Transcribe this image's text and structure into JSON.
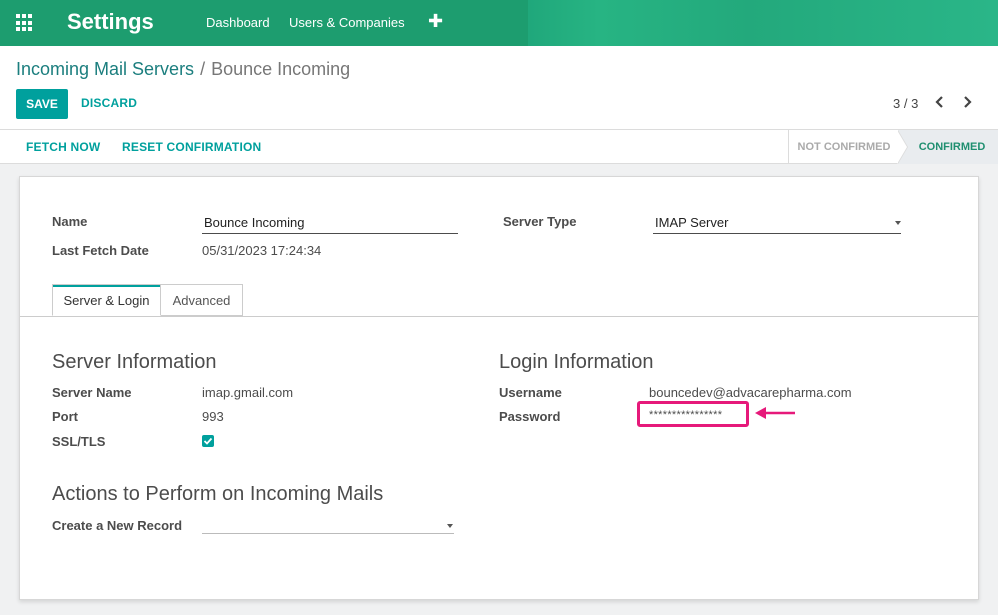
{
  "navbar": {
    "apps_icon": "apps-grid-icon",
    "brand": "Settings",
    "items": [
      "Dashboard",
      "Users & Companies"
    ],
    "plus": "✚",
    "color": "#1fa67a"
  },
  "breadcrumb": {
    "parent": "Incoming Mail Servers",
    "separator": "/",
    "current": "Bounce Incoming"
  },
  "actions": {
    "save": "SAVE",
    "discard": "DISCARD",
    "accent": "#00a09d"
  },
  "pager": {
    "value": "3 / 3",
    "prev_icon": "chevron-left-icon",
    "next_icon": "chevron-right-icon"
  },
  "statusbar": {
    "fetch_now": "FETCH NOW",
    "reset_confirmation": "RESET CONFIRMATION",
    "stages": [
      "NOT CONFIRMED",
      "CONFIRMED"
    ],
    "active_stage": "CONFIRMED"
  },
  "form": {
    "name_label": "Name",
    "name_value": "Bounce Incoming",
    "last_fetch_label": "Last Fetch Date",
    "last_fetch_value": "05/31/2023 17:24:34",
    "server_type_label": "Server Type",
    "server_type_value": "IMAP Server"
  },
  "tabs": [
    "Server & Login",
    "Advanced"
  ],
  "server_info": {
    "title": "Server Information",
    "server_name_label": "Server Name",
    "server_name_value": "imap.gmail.com",
    "port_label": "Port",
    "port_value": "993",
    "ssl_label": "SSL/TLS",
    "ssl_checked": true
  },
  "login_info": {
    "title": "Login Information",
    "username_label": "Username",
    "username_value": "bouncedev@advacarepharma.com",
    "password_label": "Password",
    "password_value": "****************",
    "highlight_color": "#e6197a"
  },
  "actions_section": {
    "title": "Actions to Perform on Incoming Mails",
    "create_record_label": "Create a New Record",
    "create_record_value": ""
  }
}
